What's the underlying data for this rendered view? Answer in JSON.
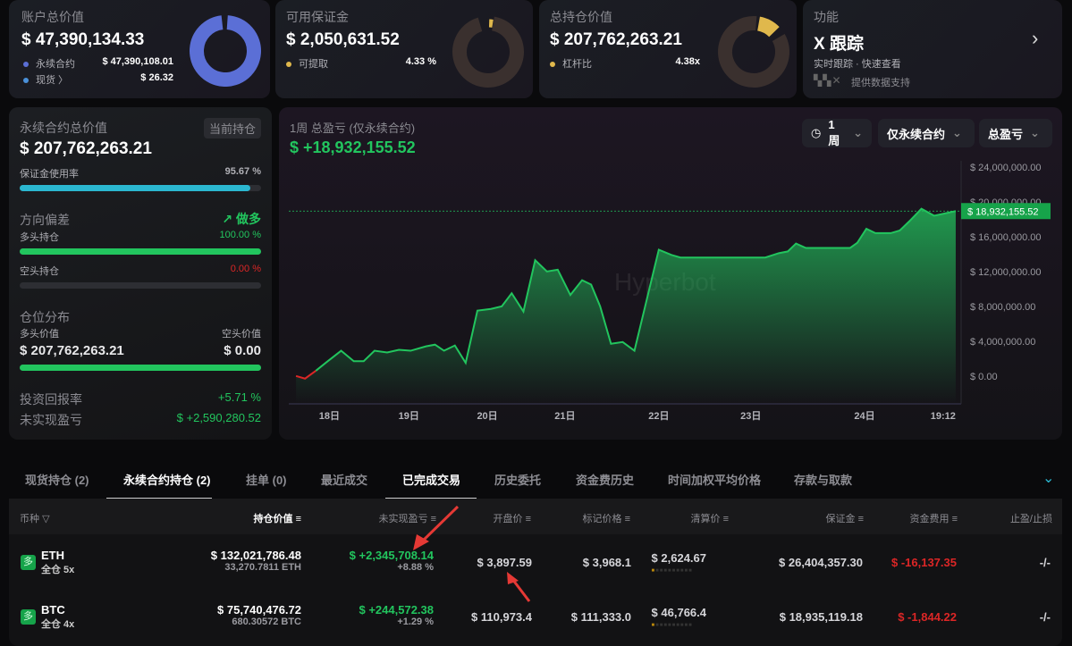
{
  "cards": [
    {
      "title": "账户总价值",
      "value": "$ 47,390,134.33",
      "rows": [
        {
          "label": "永续合约",
          "value": "$ 47,390,108.01",
          "color": "#5b6fd6"
        },
        {
          "label": "现货 〉",
          "value": "$ 26.32",
          "color": "#4a90d9"
        }
      ]
    },
    {
      "title": "可用保证金",
      "value": "$ 2,050,631.52",
      "rows": [
        {
          "label": "可提取",
          "value": "4.33 %",
          "color": "#e0b84c"
        }
      ]
    },
    {
      "title": "总持仓价值",
      "value": "$ 207,762,263.21",
      "rows": [
        {
          "label": "杠杆比",
          "value": "4.38x",
          "color": "#e0b84c"
        }
      ]
    },
    {
      "title": "功能",
      "value": "X 跟踪",
      "subtitle": "实时跟踪 · 快速查看",
      "provider": "提供数据支持",
      "logo": "bbx"
    }
  ],
  "donuts": {
    "account_perp_fraction": 0.9999,
    "margin_withdrawable_pct": 4.33,
    "leverage": 4.38
  },
  "left": {
    "title": "永续合约总价值",
    "badge": "当前持仓",
    "value": "$ 207,762,263.21",
    "margin_usage_label": "保证金使用率",
    "margin_usage": "95.67 %",
    "margin_usage_pct": 95.67,
    "direction_label": "方向偏差",
    "direction": "做多",
    "long_label": "多头持仓",
    "long_pct_text": "100.00 %",
    "long_pct": 100,
    "short_label": "空头持仓",
    "short_pct_text": "0.00 %",
    "short_pct": 0,
    "dist_label": "仓位分布",
    "long_value_label": "多头价值",
    "short_value_label": "空头价值",
    "long_value": "$ 207,762,263.21",
    "short_value": "$ 0.00",
    "roi_label": "投资回报率",
    "roi": "+5.71 %",
    "upnl_label": "未实现盈亏",
    "upnl": "$ +2,590,280.52"
  },
  "chart_panel": {
    "title": "1周 总盈亏 (仅永续合约)",
    "value": "$ +18,932,155.52",
    "filters": [
      "1周",
      "仅永续合约",
      "总盈亏"
    ],
    "watermark": "Hyperbot"
  },
  "chart_data": {
    "type": "area",
    "title": "1周 总盈亏 (仅永续合约)",
    "x": [
      17.63,
      17.73,
      17.85,
      17.97,
      18.13,
      18.27,
      18.38,
      18.5,
      18.64,
      18.77,
      18.9,
      19.07,
      19.17,
      19.27,
      19.39,
      19.51,
      19.64,
      19.79,
      19.91,
      20.02,
      20.15,
      20.28,
      20.41,
      20.53,
      20.67,
      20.8,
      20.9,
      21.0,
      21.12,
      21.25,
      21.38,
      21.65,
      21.79,
      21.89,
      22.83,
      22.98,
      23.08,
      23.17,
      23.28,
      23.77,
      23.85,
      23.95,
      24.05,
      24.22,
      24.32,
      24.43,
      24.56,
      24.7,
      24.94
    ],
    "y": [
      0.0,
      -0.3,
      0.6,
      1.6,
      2.9,
      1.7,
      1.7,
      2.9,
      2.7,
      3.0,
      2.9,
      3.4,
      3.6,
      2.9,
      3.5,
      1.5,
      7.5,
      7.7,
      8.0,
      9.5,
      7.4,
      13.3,
      12.0,
      12.2,
      9.3,
      11.0,
      10.5,
      8.0,
      3.7,
      3.9,
      2.9,
      14.5,
      13.9,
      13.6,
      13.6,
      14.1,
      14.3,
      15.2,
      14.7,
      14.7,
      15.3,
      16.9,
      16.4,
      16.4,
      16.7,
      17.8,
      19.2,
      18.4,
      18.93
    ],
    "y_unit": "million USD",
    "x_ticks": [
      {
        "v": 18.0,
        "label": "18日"
      },
      {
        "v": 18.88,
        "label": "19日"
      },
      {
        "v": 19.75,
        "label": "20日"
      },
      {
        "v": 20.61,
        "label": "21日"
      },
      {
        "v": 21.65,
        "label": "22日"
      },
      {
        "v": 22.67,
        "label": "23日"
      },
      {
        "v": 23.93,
        "label": "24日"
      },
      {
        "v": 24.8,
        "label": "19:12"
      }
    ],
    "y_ticks": [
      {
        "v": 0,
        "label": "$ 0.00"
      },
      {
        "v": 4,
        "label": "$ 4,000,000.00"
      },
      {
        "v": 8,
        "label": "$ 8,000,000.00"
      },
      {
        "v": 12,
        "label": "$ 12,000,000.00"
      },
      {
        "v": 16,
        "label": "$ 16,000,000.00"
      },
      {
        "v": 20,
        "label": "$ 20,000,000.00"
      },
      {
        "v": 24,
        "label": "$ 24,000,000.00"
      }
    ],
    "last_label": "$ 18,932,155.52",
    "last_value": 18.93,
    "xlim": [
      17.55,
      25.0
    ],
    "ylim": [
      -3.2,
      24.7
    ],
    "grid": false,
    "line_color": "#22c55e",
    "negative_color": "#dc2626"
  },
  "tabs": [
    "现货持仓 (2)",
    "永续合约持仓 (2)",
    "挂单 (0)",
    "最近成交",
    "已完成交易",
    "历史委托",
    "资金费历史",
    "时间加权平均价格",
    "存款与取款"
  ],
  "table": {
    "headers": [
      "币种",
      "持仓价值",
      "未实现盈亏",
      "开盘价",
      "标记价格",
      "清算价",
      "保证金",
      "资金费用",
      "止盈/止损"
    ],
    "rows": [
      {
        "side": "多",
        "coin": "ETH",
        "mode": "全仓 5x",
        "value": "$ 132,021,786.48",
        "size": "33,270.7811 ETH",
        "upnl": "$ +2,345,708.14",
        "upnl_pct": "+8.88 %",
        "entry": "$ 3,897.59",
        "mark": "$ 3,968.1",
        "liq": "$ 2,624.67",
        "margin": "$ 26,404,357.30",
        "funding": "$ -16,137.35",
        "tpsl": "-/-"
      },
      {
        "side": "多",
        "coin": "BTC",
        "mode": "全仓 4x",
        "value": "$ 75,740,476.72",
        "size": "680.30572 BTC",
        "upnl": "$ +244,572.38",
        "upnl_pct": "+1.29 %",
        "entry": "$ 110,973.4",
        "mark": "$ 111,333.0",
        "liq": "$ 46,766.4",
        "margin": "$ 18,935,119.18",
        "funding": "$ -1,844.22",
        "tpsl": "-/-"
      }
    ]
  }
}
